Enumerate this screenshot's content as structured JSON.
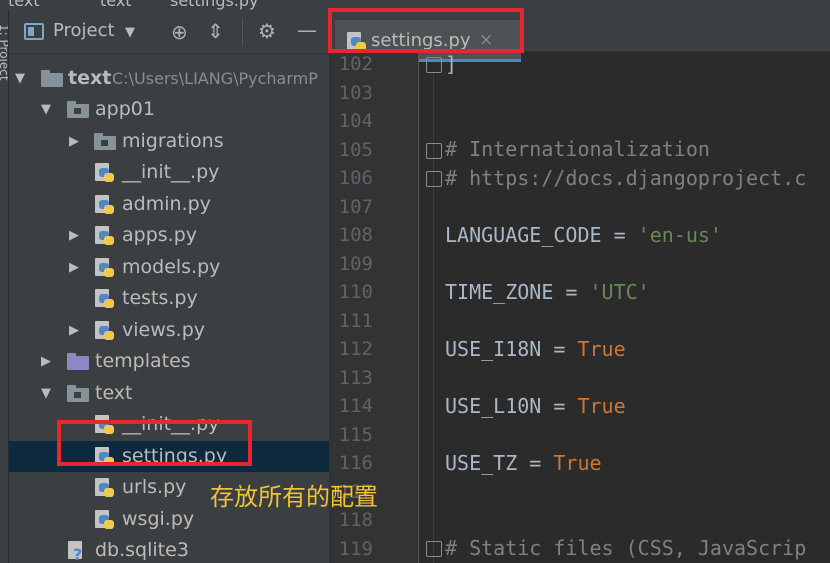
{
  "crumbs": [
    "text",
    "text",
    "settings.py"
  ],
  "project_panel": {
    "title": "Project",
    "icons": [
      "locate-icon",
      "collapse-icon",
      "gear-icon",
      "hide-icon"
    ]
  },
  "tree": [
    {
      "label": "text",
      "hint": "C:\\Users\\LIANG\\PycharmP",
      "type": "folder-grey",
      "bold": true,
      "expanded": true
    },
    {
      "label": "app01",
      "type": "folder-grey",
      "expanded": true
    },
    {
      "label": "migrations",
      "type": "folder-grey",
      "collapsed": true
    },
    {
      "label": "__init__.py",
      "type": "py"
    },
    {
      "label": "admin.py",
      "type": "py"
    },
    {
      "label": "apps.py",
      "type": "py",
      "collapsed": true
    },
    {
      "label": "models.py",
      "type": "py",
      "collapsed": true
    },
    {
      "label": "tests.py",
      "type": "py"
    },
    {
      "label": "views.py",
      "type": "py",
      "collapsed": true
    },
    {
      "label": "templates",
      "type": "folder-purple",
      "collapsed": true
    },
    {
      "label": "text",
      "type": "folder-grey",
      "expanded": true
    },
    {
      "label": "__init__.py",
      "type": "py"
    },
    {
      "label": "settings.py",
      "type": "py",
      "selected": true
    },
    {
      "label": "urls.py",
      "type": "py"
    },
    {
      "label": "wsgi.py",
      "type": "py"
    },
    {
      "label": "db.sqlite3",
      "type": "db"
    }
  ],
  "editor": {
    "tab_label": "settings.py",
    "tab_close": "×",
    "line_numbers": [
      "102",
      "103",
      "104",
      "105",
      "106",
      "107",
      "108",
      "109",
      "110",
      "111",
      "112",
      "113",
      "114",
      "115",
      "116",
      "117",
      "118",
      "119"
    ],
    "code": {
      "l102": "]",
      "l105": "# Internationalization",
      "l106": "# https://docs.djangoproject.c",
      "l108_var": "LANGUAGE_CODE = ",
      "l108_str": "'en-us'",
      "l110_var": "TIME_ZONE = ",
      "l110_str": "'UTC'",
      "l112_var": "USE_I18N = ",
      "l112_kw": "True",
      "l114_var": "USE_L10N = ",
      "l114_kw": "True",
      "l116_var": "USE_TZ = ",
      "l116_kw": "True",
      "l119": "# Static files (CSS, JavaScrip"
    }
  },
  "annotation": {
    "note": "存放所有的配置",
    "color": "#e8262f"
  }
}
